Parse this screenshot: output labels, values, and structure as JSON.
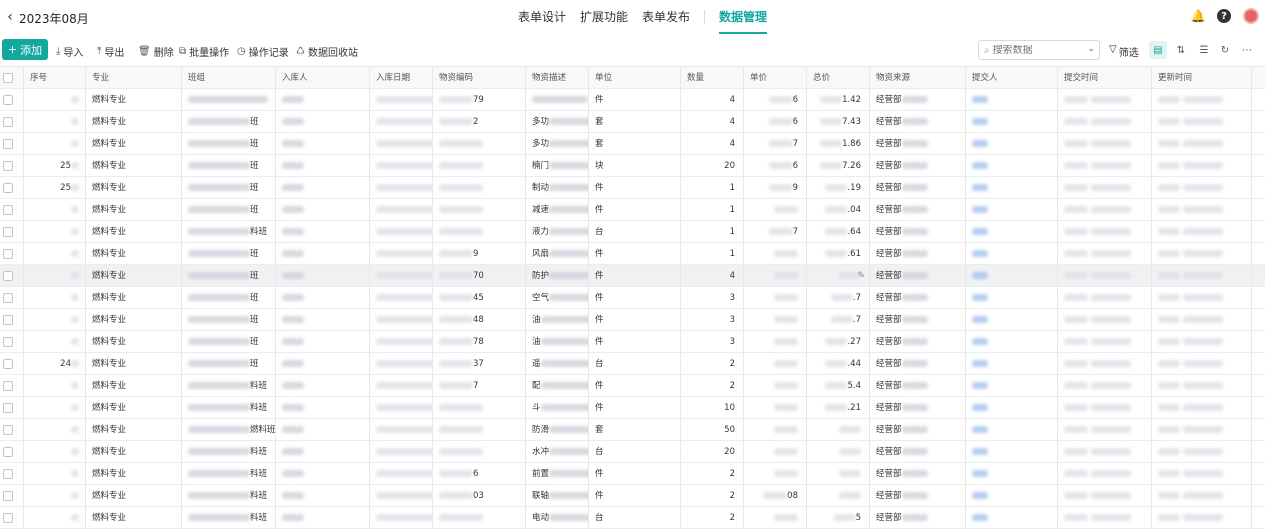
{
  "header": {
    "title": "2023年08月",
    "nav": [
      "表单设计",
      "扩展功能",
      "表单发布",
      "数据管理"
    ],
    "active_nav": "数据管理"
  },
  "toolbar": {
    "add": "添加",
    "import": "导入",
    "export": "导出",
    "delete": "删除",
    "batch": "批量操作",
    "log": "操作记录",
    "recycle": "数据回收站",
    "search_placeholder": "搜索数据",
    "filter": "筛选"
  },
  "table": {
    "columns": [
      "序号",
      "专业",
      "班组",
      "入库人",
      "入库日期",
      "物资编码",
      "物资描述",
      "单位",
      "数量",
      "单价",
      "总价",
      "物资来源",
      "提交人",
      "提交时间",
      "更新时间"
    ],
    "rows": [
      {
        "seq": "",
        "major": "燃料专业",
        "team": "",
        "person": "",
        "date": "0:00",
        "code": "79",
        "desc": "",
        "unit": "件",
        "qty": "4",
        "price": "6",
        "total": "1.42",
        "source": "经营部"
      },
      {
        "seq": "",
        "major": "燃料专业",
        "team": "班",
        "person": "",
        "date": "0:00",
        "code": "2",
        "desc": "多功",
        "unit": "套",
        "qty": "4",
        "price": "6",
        "total": "7.43",
        "source": "经营部"
      },
      {
        "seq": "",
        "major": "燃料专业",
        "team": "班",
        "person": "",
        "date": "0:00",
        "code": "",
        "desc": "多功",
        "unit": "套",
        "qty": "4",
        "price": "7",
        "total": "1.86",
        "source": "经营部"
      },
      {
        "seq": "25",
        "major": "燃料专业",
        "team": "班",
        "person": "",
        "date": "0:00",
        "code": "",
        "desc": "楠门",
        "unit": "块",
        "qty": "20",
        "price": "6",
        "total": "7.26",
        "source": "经营部"
      },
      {
        "seq": "25",
        "major": "燃料专业",
        "team": "班",
        "person": "",
        "date": "0:00",
        "code": "",
        "desc": "制动",
        "unit": "件",
        "qty": "1",
        "price": "9",
        "total": ".19",
        "source": "经营部"
      },
      {
        "seq": "",
        "major": "燃料专业",
        "team": "班",
        "person": "",
        "date": "00",
        "code": "",
        "desc": "减速",
        "unit": "件",
        "qty": "1",
        "price": "",
        "total": ".04",
        "source": "经营部"
      },
      {
        "seq": "",
        "major": "燃料专业",
        "team": "料班",
        "person": "",
        "date": "00",
        "code": "",
        "desc": "液力",
        "unit": "台",
        "qty": "1",
        "price": "7",
        "total": ".64",
        "source": "经营部"
      },
      {
        "seq": "",
        "major": "燃料专业",
        "team": "班",
        "person": "",
        "date": "00",
        "code": "9",
        "desc": "风扇",
        "unit": "件",
        "qty": "1",
        "price": "",
        "total": ".61",
        "source": "经营部"
      },
      {
        "seq": "",
        "major": "燃料专业",
        "team": "班",
        "person": "",
        "date": "",
        "code": "70",
        "desc": "防护",
        "unit": "件",
        "qty": "4",
        "price": "",
        "total": "",
        "source": "经营部"
      },
      {
        "seq": "",
        "major": "燃料专业",
        "team": "班",
        "person": "",
        "date": "",
        "code": "45",
        "desc": "空气",
        "unit": "件",
        "qty": "3",
        "price": "",
        "total": ".7",
        "source": "经营部"
      },
      {
        "seq": "",
        "major": "燃料专业",
        "team": "班",
        "person": "",
        "date": "",
        "code": "48",
        "desc": "油",
        "unit": "件",
        "qty": "3",
        "price": "",
        "total": ".7",
        "source": "经营部"
      },
      {
        "seq": "",
        "major": "燃料专业",
        "team": "班",
        "person": "",
        "date": "",
        "code": "78",
        "desc": "油",
        "unit": "件",
        "qty": "3",
        "price": "",
        "total": ".27",
        "source": "经营部"
      },
      {
        "seq": "24",
        "major": "燃料专业",
        "team": "班",
        "person": "",
        "date": "",
        "code": "37",
        "desc": "遥",
        "unit": "台",
        "qty": "2",
        "price": "",
        "total": ".44",
        "source": "经营部"
      },
      {
        "seq": "",
        "major": "燃料专业",
        "team": "料班",
        "person": "",
        "date": "",
        "code": "7",
        "desc": "配",
        "unit": "件",
        "qty": "2",
        "price": "",
        "total": "5.4",
        "source": "经营部"
      },
      {
        "seq": "",
        "major": "燃料专业",
        "team": "料班",
        "person": "",
        "date": "0",
        "code": "",
        "desc": "斗",
        "unit": "件",
        "qty": "10",
        "price": "",
        "total": ".21",
        "source": "经营部"
      },
      {
        "seq": "",
        "major": "燃料专业",
        "team": "燃料班",
        "person": "",
        "date": "0",
        "code": "",
        "desc": "防滑",
        "unit": "套",
        "qty": "50",
        "price": "",
        "total": "",
        "source": "经营部"
      },
      {
        "seq": "",
        "major": "燃料专业",
        "team": "料班",
        "person": "",
        "date": "0",
        "code": "",
        "desc": "水冲",
        "unit": "台",
        "qty": "20",
        "price": "",
        "total": "",
        "source": "经营部"
      },
      {
        "seq": "",
        "major": "燃料专业",
        "team": "科班",
        "person": "",
        "date": "",
        "code": "6",
        "desc": "前置",
        "unit": "件",
        "qty": "2",
        "price": "",
        "total": "",
        "source": "经营部"
      },
      {
        "seq": "",
        "major": "燃料专业",
        "team": "料班",
        "person": "",
        "date": "",
        "code": "03",
        "desc": "联轴",
        "unit": "件",
        "qty": "2",
        "price": "08",
        "total": "",
        "source": "经营部"
      },
      {
        "seq": "",
        "major": "燃料专业",
        "team": "料班",
        "person": "",
        "date": "",
        "code": "",
        "desc": "电动",
        "unit": "台",
        "qty": "2",
        "price": "",
        "total": "5",
        "source": "经营部"
      }
    ]
  }
}
